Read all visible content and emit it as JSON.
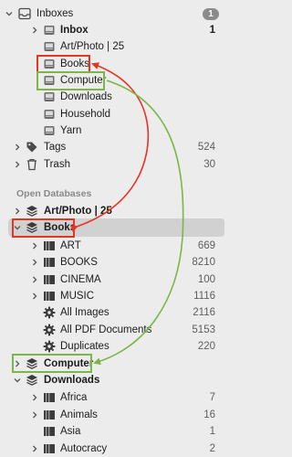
{
  "colors": {
    "red": "#e53324",
    "green": "#7ab648",
    "badge": "#8b8b8b",
    "selected": "#d1d1d1"
  },
  "inboxes": {
    "label": "Inboxes",
    "badge": "1",
    "icon": "inbox-tray-icon"
  },
  "inbox_items": [
    {
      "label": "Inbox",
      "count": "1",
      "bold": true,
      "chevron": true
    },
    {
      "label": "Art/Photo | 25",
      "count": ""
    },
    {
      "label": "Books",
      "count": ""
    },
    {
      "label": "Computer",
      "count": ""
    },
    {
      "label": "Downloads",
      "count": ""
    },
    {
      "label": "Household",
      "count": ""
    },
    {
      "label": "Yarn",
      "count": ""
    }
  ],
  "tags": {
    "label": "Tags",
    "count": "524",
    "icon": "tag-icon"
  },
  "trash": {
    "label": "Trash",
    "count": "30",
    "icon": "trash-icon"
  },
  "open_databases": {
    "header": "Open Databases"
  },
  "databases": {
    "artphoto": {
      "label": "Art/Photo | 25"
    },
    "books": {
      "label": "Books"
    },
    "computer": {
      "label": "Computer"
    },
    "downloads": {
      "label": "Downloads"
    }
  },
  "books_items": [
    {
      "label": "ART",
      "count": "669",
      "icon": "group-icon",
      "chevron": true
    },
    {
      "label": "BOOKS",
      "count": "8210",
      "icon": "group-icon",
      "chevron": true
    },
    {
      "label": "CINEMA",
      "count": "100",
      "icon": "group-icon",
      "chevron": true
    },
    {
      "label": "MUSIC",
      "count": "1116",
      "icon": "group-icon",
      "chevron": true
    },
    {
      "label": "All Images",
      "count": "2116",
      "icon": "smart-group-gear-icon",
      "chevron": false
    },
    {
      "label": "All PDF Documents",
      "count": "5153",
      "icon": "smart-group-gear-icon",
      "chevron": false
    },
    {
      "label": "Duplicates",
      "count": "220",
      "icon": "smart-group-gear-icon",
      "chevron": false
    }
  ],
  "downloads_items": [
    {
      "label": "Africa",
      "count": "7",
      "icon": "group-icon",
      "chevron": true
    },
    {
      "label": "Animals",
      "count": "16",
      "icon": "group-icon",
      "chevron": true
    },
    {
      "label": "Asia",
      "count": "1",
      "icon": "group-icon",
      "chevron": false
    },
    {
      "label": "Autocracy",
      "count": "2",
      "icon": "group-icon",
      "chevron": true
    }
  ]
}
